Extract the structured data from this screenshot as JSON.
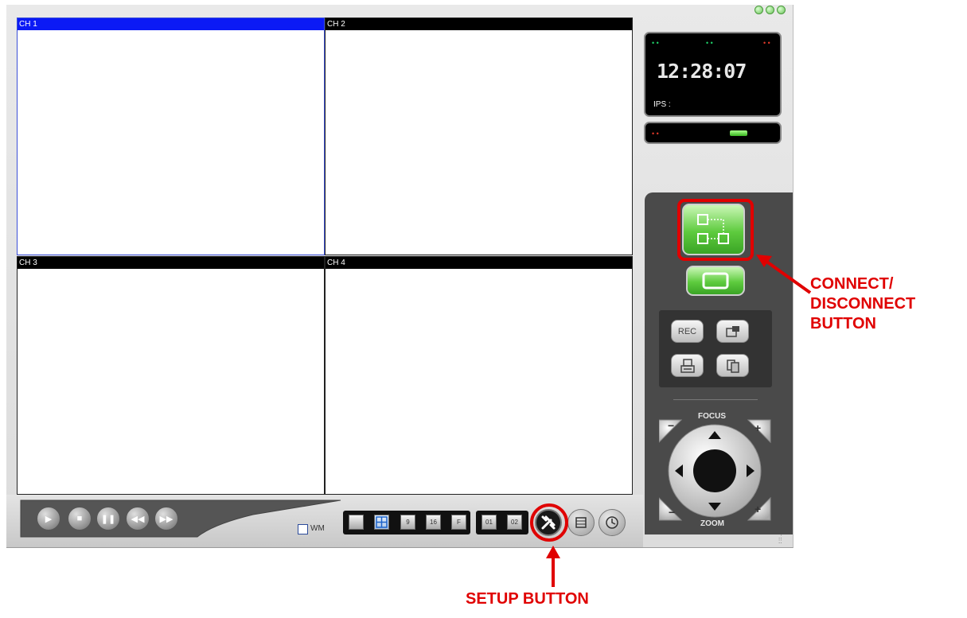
{
  "channels": [
    {
      "label": "CH 1"
    },
    {
      "label": "CH 2"
    },
    {
      "label": "CH 3"
    },
    {
      "label": "CH 4"
    }
  ],
  "status_panel": {
    "digits": "12:28:07",
    "ips_label": "IPS :"
  },
  "buttons": {
    "rec": "REC"
  },
  "ptz": {
    "focus_label": "FOCUS",
    "zoom_label": "ZOOM",
    "minus": "−",
    "plus": "+"
  },
  "bottom": {
    "wm_label": "WM",
    "layout": [
      "9",
      "16",
      "F"
    ],
    "pages": [
      "01",
      "02"
    ]
  },
  "annotations": {
    "connect_line1": "CONNECT/",
    "connect_line2": "DISCONNECT",
    "connect_line3": "BUTTON",
    "setup": "SETUP BUTTON"
  },
  "colors": {
    "annotation": "#e00000",
    "active_channel": "#0b1af5",
    "green_button": "#5ecb3e"
  }
}
